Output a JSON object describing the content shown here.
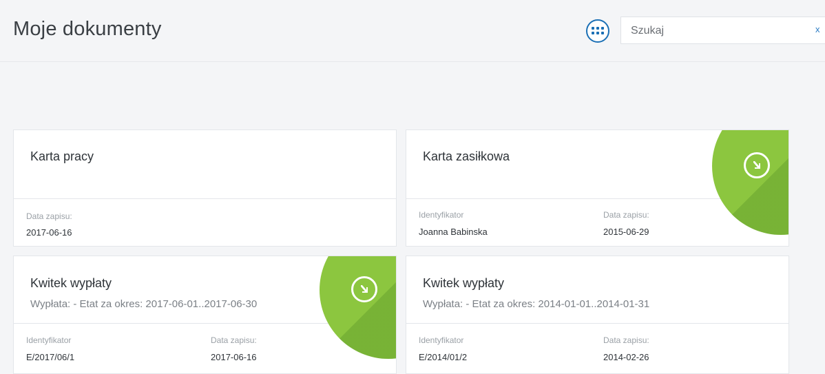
{
  "header": {
    "title": "Moje dokumenty",
    "view_toggle_icon": "grid-icon",
    "search": {
      "placeholder": "Szukaj",
      "clear_label": "x"
    }
  },
  "colors": {
    "accent": "#1a6fb5",
    "download_badge": "#8cc63f"
  },
  "documents": [
    {
      "title": "Karta pracy",
      "subtitle": "",
      "date_label": "Data zapisu:",
      "date_value": "2017-06-16"
    },
    {
      "title": "Karta zasiłkowa",
      "subtitle": "",
      "id_label": "Identyfikator",
      "id_value": "Joanna Babinska",
      "date_label": "Data zapisu:",
      "date_value": "2015-06-29",
      "download_icon": "download-arrow-icon"
    },
    {
      "title": "Kwitek wypłaty",
      "subtitle": "Wypłata: - Etat za okres: 2017-06-01..2017-06-30",
      "id_label": "Identyfikator",
      "id_value": "E/2017/06/1",
      "date_label": "Data zapisu:",
      "date_value": "2017-06-16",
      "download_icon": "download-arrow-icon"
    },
    {
      "title": "Kwitek wypłaty",
      "subtitle": "Wypłata: - Etat za okres: 2014-01-01..2014-01-31",
      "id_label": "Identyfikator",
      "id_value": "E/2014/01/2",
      "date_label": "Data zapisu:",
      "date_value": "2014-02-26"
    }
  ]
}
